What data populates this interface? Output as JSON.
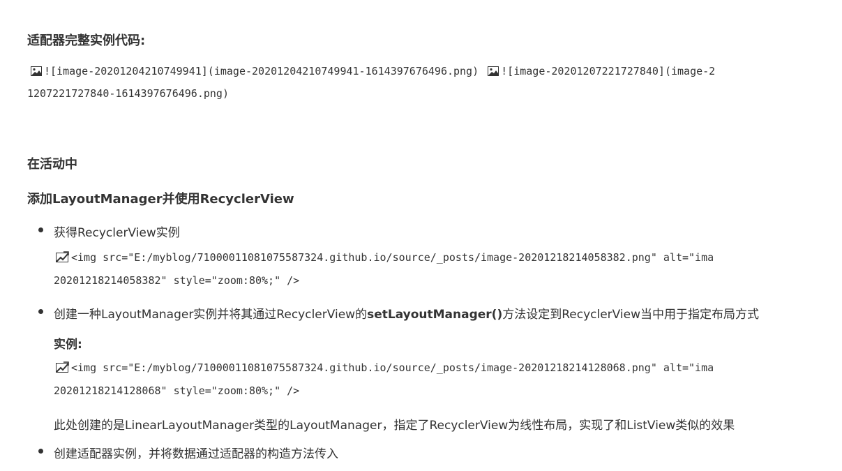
{
  "heading_adapter": "适配器完整实例代码:",
  "img_line1": "![image-20201204210749941](image-20201204210749941-1614397676496.png)",
  "img_line1b": "![image-20201207221727840](image-2",
  "img_line2": "1207221727840-1614397676496.png)",
  "heading_activity": "在活动中",
  "heading_layout": "添加LayoutManager并使用RecyclerView",
  "bullet1": "获得RecyclerView实例",
  "code1_line1": "<img src=\"E:/myblog/71000011081075587324.github.io/source/_posts/image-20201218214058382.png\" alt=\"ima",
  "code1_line2": "20201218214058382\" style=\"zoom:80%;\" />",
  "bullet2_pre": "创建一种LayoutManager实例并将其通过RecyclerView的",
  "bullet2_bold": "setLayoutManager()",
  "bullet2_post": "方法设定到RecyclerView当中用于指定布局方式",
  "example_label": "实例:",
  "code2_line1": "<img src=\"E:/myblog/71000011081075587324.github.io/source/_posts/image-20201218214128068.png\" alt=\"ima",
  "code2_line2": "20201218214128068\" style=\"zoom:80%;\" />",
  "note": "此处创建的是LinearLayoutManager类型的LayoutManager，指定了RecyclerView为线性布局，实现了和ListView类似的效果",
  "bullet3": "创建适配器实例，并将数据通过适配器的构造方法传入"
}
